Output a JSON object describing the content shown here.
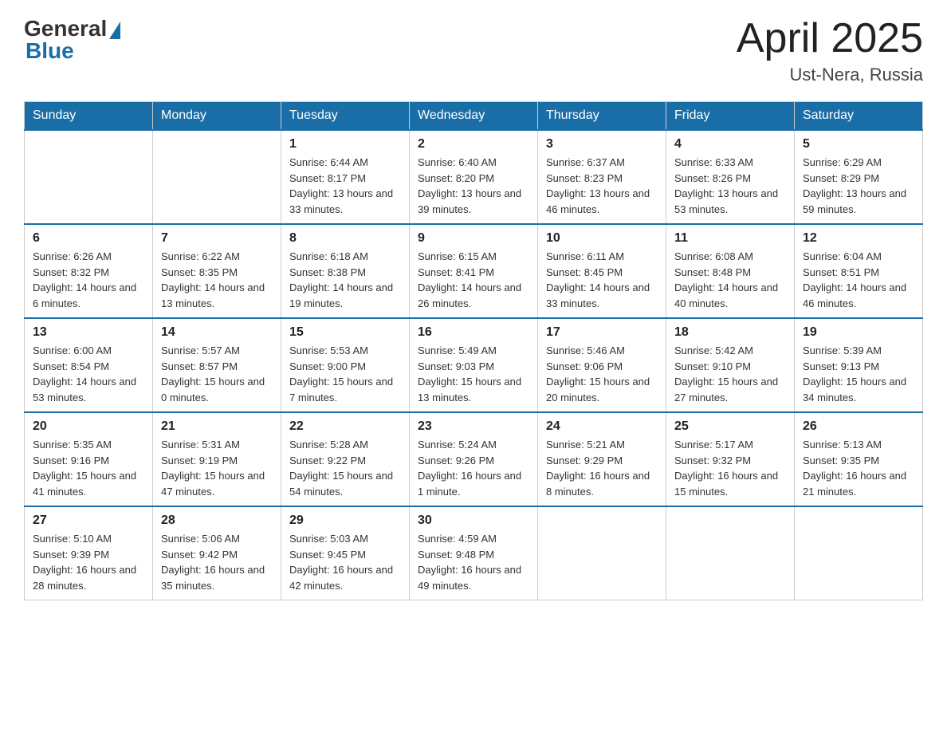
{
  "header": {
    "logo_general": "General",
    "logo_blue": "Blue",
    "month_title": "April 2025",
    "location": "Ust-Nera, Russia"
  },
  "days_of_week": [
    "Sunday",
    "Monday",
    "Tuesday",
    "Wednesday",
    "Thursday",
    "Friday",
    "Saturday"
  ],
  "weeks": [
    [
      {
        "day": "",
        "info": ""
      },
      {
        "day": "",
        "info": ""
      },
      {
        "day": "1",
        "info": "Sunrise: 6:44 AM\nSunset: 8:17 PM\nDaylight: 13 hours\nand 33 minutes."
      },
      {
        "day": "2",
        "info": "Sunrise: 6:40 AM\nSunset: 8:20 PM\nDaylight: 13 hours\nand 39 minutes."
      },
      {
        "day": "3",
        "info": "Sunrise: 6:37 AM\nSunset: 8:23 PM\nDaylight: 13 hours\nand 46 minutes."
      },
      {
        "day": "4",
        "info": "Sunrise: 6:33 AM\nSunset: 8:26 PM\nDaylight: 13 hours\nand 53 minutes."
      },
      {
        "day": "5",
        "info": "Sunrise: 6:29 AM\nSunset: 8:29 PM\nDaylight: 13 hours\nand 59 minutes."
      }
    ],
    [
      {
        "day": "6",
        "info": "Sunrise: 6:26 AM\nSunset: 8:32 PM\nDaylight: 14 hours\nand 6 minutes."
      },
      {
        "day": "7",
        "info": "Sunrise: 6:22 AM\nSunset: 8:35 PM\nDaylight: 14 hours\nand 13 minutes."
      },
      {
        "day": "8",
        "info": "Sunrise: 6:18 AM\nSunset: 8:38 PM\nDaylight: 14 hours\nand 19 minutes."
      },
      {
        "day": "9",
        "info": "Sunrise: 6:15 AM\nSunset: 8:41 PM\nDaylight: 14 hours\nand 26 minutes."
      },
      {
        "day": "10",
        "info": "Sunrise: 6:11 AM\nSunset: 8:45 PM\nDaylight: 14 hours\nand 33 minutes."
      },
      {
        "day": "11",
        "info": "Sunrise: 6:08 AM\nSunset: 8:48 PM\nDaylight: 14 hours\nand 40 minutes."
      },
      {
        "day": "12",
        "info": "Sunrise: 6:04 AM\nSunset: 8:51 PM\nDaylight: 14 hours\nand 46 minutes."
      }
    ],
    [
      {
        "day": "13",
        "info": "Sunrise: 6:00 AM\nSunset: 8:54 PM\nDaylight: 14 hours\nand 53 minutes."
      },
      {
        "day": "14",
        "info": "Sunrise: 5:57 AM\nSunset: 8:57 PM\nDaylight: 15 hours\nand 0 minutes."
      },
      {
        "day": "15",
        "info": "Sunrise: 5:53 AM\nSunset: 9:00 PM\nDaylight: 15 hours\nand 7 minutes."
      },
      {
        "day": "16",
        "info": "Sunrise: 5:49 AM\nSunset: 9:03 PM\nDaylight: 15 hours\nand 13 minutes."
      },
      {
        "day": "17",
        "info": "Sunrise: 5:46 AM\nSunset: 9:06 PM\nDaylight: 15 hours\nand 20 minutes."
      },
      {
        "day": "18",
        "info": "Sunrise: 5:42 AM\nSunset: 9:10 PM\nDaylight: 15 hours\nand 27 minutes."
      },
      {
        "day": "19",
        "info": "Sunrise: 5:39 AM\nSunset: 9:13 PM\nDaylight: 15 hours\nand 34 minutes."
      }
    ],
    [
      {
        "day": "20",
        "info": "Sunrise: 5:35 AM\nSunset: 9:16 PM\nDaylight: 15 hours\nand 41 minutes."
      },
      {
        "day": "21",
        "info": "Sunrise: 5:31 AM\nSunset: 9:19 PM\nDaylight: 15 hours\nand 47 minutes."
      },
      {
        "day": "22",
        "info": "Sunrise: 5:28 AM\nSunset: 9:22 PM\nDaylight: 15 hours\nand 54 minutes."
      },
      {
        "day": "23",
        "info": "Sunrise: 5:24 AM\nSunset: 9:26 PM\nDaylight: 16 hours\nand 1 minute."
      },
      {
        "day": "24",
        "info": "Sunrise: 5:21 AM\nSunset: 9:29 PM\nDaylight: 16 hours\nand 8 minutes."
      },
      {
        "day": "25",
        "info": "Sunrise: 5:17 AM\nSunset: 9:32 PM\nDaylight: 16 hours\nand 15 minutes."
      },
      {
        "day": "26",
        "info": "Sunrise: 5:13 AM\nSunset: 9:35 PM\nDaylight: 16 hours\nand 21 minutes."
      }
    ],
    [
      {
        "day": "27",
        "info": "Sunrise: 5:10 AM\nSunset: 9:39 PM\nDaylight: 16 hours\nand 28 minutes."
      },
      {
        "day": "28",
        "info": "Sunrise: 5:06 AM\nSunset: 9:42 PM\nDaylight: 16 hours\nand 35 minutes."
      },
      {
        "day": "29",
        "info": "Sunrise: 5:03 AM\nSunset: 9:45 PM\nDaylight: 16 hours\nand 42 minutes."
      },
      {
        "day": "30",
        "info": "Sunrise: 4:59 AM\nSunset: 9:48 PM\nDaylight: 16 hours\nand 49 minutes."
      },
      {
        "day": "",
        "info": ""
      },
      {
        "day": "",
        "info": ""
      },
      {
        "day": "",
        "info": ""
      }
    ]
  ]
}
